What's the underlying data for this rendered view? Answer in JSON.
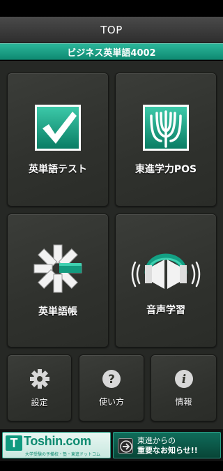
{
  "header": {
    "title": "TOP"
  },
  "app": {
    "subtitle": "ビジネス英単語4002"
  },
  "menu": {
    "vocab_test": "英単語テスト",
    "toshin_pos": "東進学力POS",
    "wordbook": "英単語帳",
    "audio": "音声学習",
    "settings": "設定",
    "howto": "使い方",
    "info": "情報"
  },
  "footer": {
    "logo_mark": "T",
    "logo_text": "Toshin.com",
    "logo_sub": "大学受験の予備校・塾・東進ドットコム",
    "news_line1": "東進からの",
    "news_line2": "重要なお知らせ!!"
  },
  "colors": {
    "accent": "#109a7f",
    "tile": "#33352f",
    "background": "#262825"
  },
  "icons": {
    "vocab_test": "checkmark-icon",
    "toshin_pos": "tree-icon",
    "wordbook": "book-flip-icon",
    "audio": "headphones-icon",
    "settings": "gear-icon",
    "howto": "question-icon",
    "info": "info-icon",
    "news": "arrow-icon"
  }
}
